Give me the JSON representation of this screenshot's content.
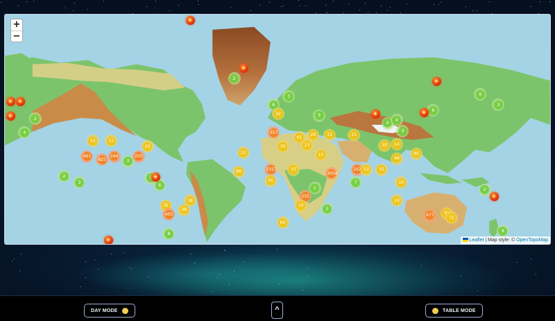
{
  "map": {
    "zoom_in_label": "+",
    "zoom_out_label": "−",
    "attribution": {
      "leaflet_label": "Leaflet",
      "separator": " | Map style: © ",
      "style_link_label": "OpenTopoMap"
    },
    "clusters": [
      {
        "label": "2",
        "tier": "small",
        "lon": -29,
        "lat": 73
      },
      {
        "label": "2",
        "tier": "small",
        "lon": -160,
        "lat": 54
      },
      {
        "label": "4",
        "tier": "small",
        "lon": -167,
        "lat": 44
      },
      {
        "label": "3",
        "tier": "small",
        "lon": -99,
        "lat": 17
      },
      {
        "label": "51",
        "tier": "medium",
        "lon": -122,
        "lat": 37
      },
      {
        "label": "13",
        "tier": "medium",
        "lon": -110,
        "lat": 37
      },
      {
        "label": "32",
        "tier": "medium",
        "lon": -86,
        "lat": 32
      },
      {
        "label": "441",
        "tier": "large",
        "lon": -126,
        "lat": 22
      },
      {
        "label": "825",
        "tier": "large",
        "lon": -116,
        "lat": 19
      },
      {
        "label": "244",
        "tier": "large",
        "lon": -108,
        "lat": 22
      },
      {
        "label": "203",
        "tier": "large",
        "lon": -92,
        "lat": 22
      },
      {
        "label": "2",
        "tier": "small",
        "lon": -141,
        "lat": 1
      },
      {
        "label": "3",
        "tier": "small",
        "lon": -131,
        "lat": -6
      },
      {
        "label": "3",
        "tier": "small",
        "lon": -84,
        "lat": -1
      },
      {
        "label": "6",
        "tier": "small",
        "lon": -78,
        "lat": -9
      },
      {
        "label": "35",
        "tier": "medium",
        "lon": -74,
        "lat": -30
      },
      {
        "label": "405",
        "tier": "large",
        "lon": -72,
        "lat": -38
      },
      {
        "label": "38",
        "tier": "medium",
        "lon": -62,
        "lat": -34
      },
      {
        "label": "18",
        "tier": "medium",
        "lon": -58,
        "lat": -25
      },
      {
        "label": "8",
        "tier": "small",
        "lon": -72,
        "lat": -53
      },
      {
        "label": "6",
        "tier": "small",
        "lon": -3,
        "lat": 62
      },
      {
        "label": "3",
        "tier": "small",
        "lon": 7,
        "lat": 66
      },
      {
        "label": "32",
        "tier": "medium",
        "lon": 0,
        "lat": 57
      },
      {
        "label": "357",
        "tier": "large",
        "lon": -3,
        "lat": 44
      },
      {
        "label": "30",
        "tier": "medium",
        "lon": 3,
        "lat": 32
      },
      {
        "label": "61",
        "tier": "medium",
        "lon": 14,
        "lat": 40
      },
      {
        "label": "29",
        "tier": "medium",
        "lon": 23,
        "lat": 42
      },
      {
        "label": "21",
        "tier": "medium",
        "lon": 34,
        "lat": 42
      },
      {
        "label": "3",
        "tier": "small",
        "lon": 27,
        "lat": 56
      },
      {
        "label": "21",
        "tier": "medium",
        "lon": 50,
        "lat": 42
      },
      {
        "label": "4",
        "tier": "small",
        "lon": 72,
        "lat": 51
      },
      {
        "label": "23",
        "tier": "medium",
        "lon": 19,
        "lat": 33
      },
      {
        "label": "13",
        "tier": "medium",
        "lon": 28,
        "lat": 24
      },
      {
        "label": "20",
        "tier": "medium",
        "lon": 70,
        "lat": 33
      },
      {
        "label": "14",
        "tier": "medium",
        "lon": 78,
        "lat": 34
      },
      {
        "label": "12",
        "tier": "medium",
        "lon": -23,
        "lat": 26
      },
      {
        "label": "88",
        "tier": "medium",
        "lon": -26,
        "lat": 6
      },
      {
        "label": "2317",
        "tier": "large",
        "lon": -5,
        "lat": 8
      },
      {
        "label": "15",
        "tier": "medium",
        "lon": 10,
        "lat": 8
      },
      {
        "label": "41",
        "tier": "medium",
        "lon": -5,
        "lat": -4
      },
      {
        "label": "3054",
        "tier": "large",
        "lon": 35,
        "lat": 4
      },
      {
        "label": "2",
        "tier": "small",
        "lon": 24,
        "lat": -12
      },
      {
        "label": "7",
        "tier": "small",
        "lon": 51,
        "lat": -6
      },
      {
        "label": "102",
        "tier": "large",
        "lon": 52,
        "lat": 8
      },
      {
        "label": "53",
        "tier": "medium",
        "lon": 58,
        "lat": 8
      },
      {
        "label": "15",
        "tier": "medium",
        "lon": 68,
        "lat": 8
      },
      {
        "label": "10",
        "tier": "medium",
        "lon": 81,
        "lat": -6
      },
      {
        "label": "46",
        "tier": "medium",
        "lon": 78,
        "lat": 20
      },
      {
        "label": "60",
        "tier": "medium",
        "lon": 91,
        "lat": 25
      },
      {
        "label": "4",
        "tier": "small",
        "lon": 78,
        "lat": 53
      },
      {
        "label": "3",
        "tier": "small",
        "lon": 82,
        "lat": 45
      },
      {
        "label": "9",
        "tier": "small",
        "lon": 102,
        "lat": 59
      },
      {
        "label": "6",
        "tier": "small",
        "lon": 133,
        "lat": 67
      },
      {
        "label": "3",
        "tier": "small",
        "lon": 145,
        "lat": 62
      },
      {
        "label": "255",
        "tier": "large",
        "lon": 18,
        "lat": -21
      },
      {
        "label": "10",
        "tier": "medium",
        "lon": 15,
        "lat": -30
      },
      {
        "label": "60",
        "tier": "medium",
        "lon": 3,
        "lat": -45
      },
      {
        "label": "3",
        "tier": "small",
        "lon": 32,
        "lat": -33
      },
      {
        "label": "19",
        "tier": "medium",
        "lon": 78,
        "lat": -25
      },
      {
        "label": "477",
        "tier": "large",
        "lon": 100,
        "lat": -39
      },
      {
        "label": "91",
        "tier": "medium",
        "lon": 111,
        "lat": -37
      },
      {
        "label": "72",
        "tier": "medium",
        "lon": 114,
        "lat": -41
      },
      {
        "label": "2",
        "tier": "small",
        "lon": 136,
        "lat": -14
      },
      {
        "label": "8",
        "tier": "small",
        "lon": 148,
        "lat": -51
      }
    ],
    "eruptions": [
      {
        "lon": -58,
        "lat": 86
      },
      {
        "lon": -23,
        "lat": 76
      },
      {
        "lon": -180,
        "lat": 64
      },
      {
        "lon": -170,
        "lat": 64
      },
      {
        "lon": -180,
        "lat": 56
      },
      {
        "lon": -81,
        "lat": 0
      },
      {
        "lon": -112,
        "lat": -59
      },
      {
        "lon": 64,
        "lat": 57
      },
      {
        "lon": 96,
        "lat": 58
      },
      {
        "lon": 104,
        "lat": 72
      },
      {
        "lon": 142,
        "lat": -21
      }
    ],
    "colors": {
      "ocean": "#a4d3e6",
      "lowland": "#79c46a",
      "upland": "#d7cf86",
      "highland": "#b9773f",
      "ice": "#eef4f6"
    }
  },
  "controls": {
    "day_mode_label": "DAY MODE",
    "up_label": "^",
    "table_mode_label": "TABLE MODE"
  }
}
